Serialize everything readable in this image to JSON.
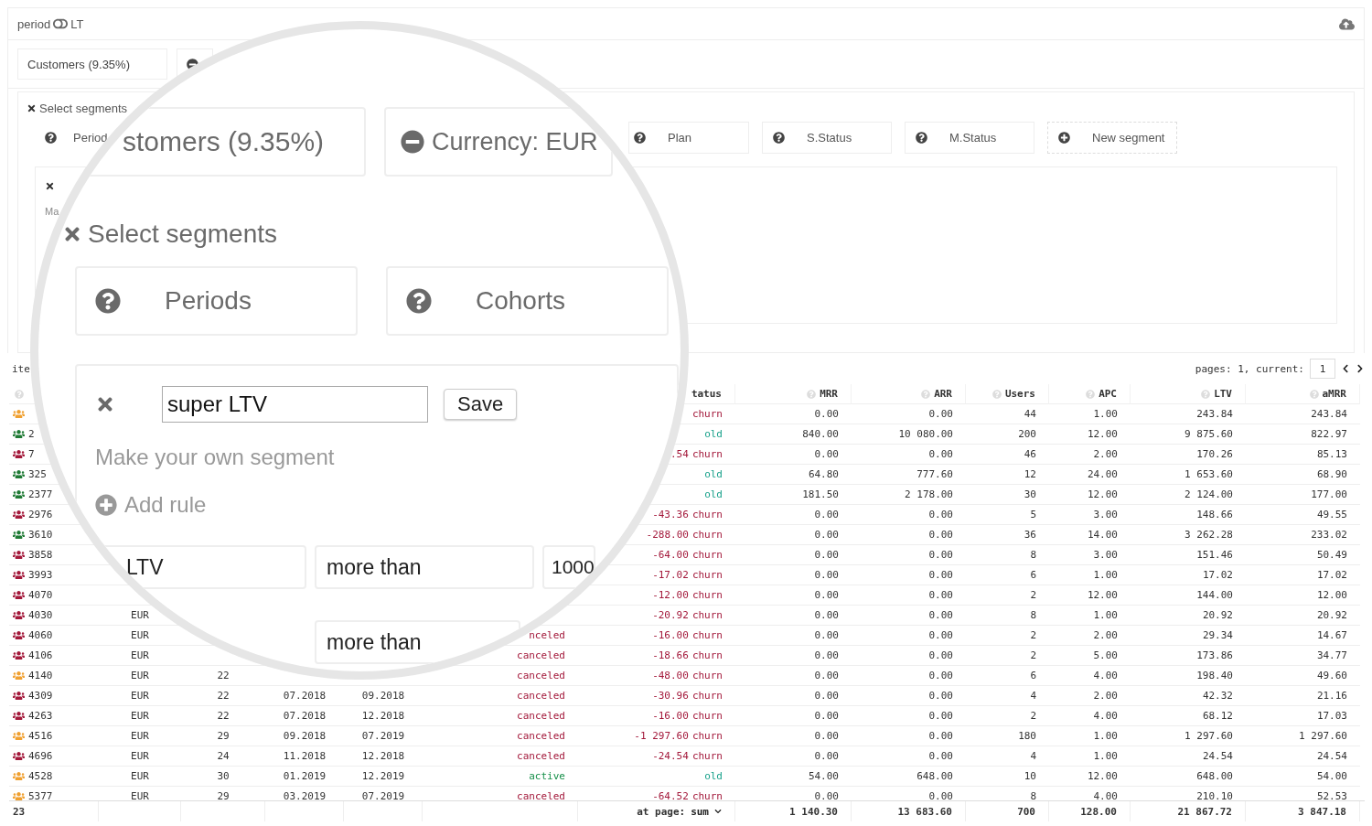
{
  "top_bar": {
    "period_label": "period",
    "on": false,
    "mode_label": "LT"
  },
  "segments": [
    {
      "kind": "label",
      "label": "Customers (9.35%)"
    },
    {
      "kind": "minus"
    }
  ],
  "select_panel": {
    "title": "Select segments",
    "buttons": [
      {
        "kind": "help",
        "label": "Period"
      },
      {
        "kind": "help",
        "label": "Plan"
      },
      {
        "kind": "help",
        "label": "S.Status"
      },
      {
        "kind": "help",
        "label": "M.Status"
      },
      {
        "kind": "new",
        "label": "New segment"
      }
    ],
    "editor_hint": "Ma"
  },
  "magnifier": {
    "segments": [
      {
        "kind": "label",
        "label": "stomers (9.35%)"
      },
      {
        "kind": "minus",
        "label": "Currency: EUR"
      }
    ],
    "title": "Select segments",
    "groups": [
      {
        "label": "Periods"
      },
      {
        "label": "Cohorts"
      }
    ],
    "editor": {
      "name": "super LTV",
      "save": "Save",
      "hint": "Make your own segment",
      "add_rule": "Add rule",
      "rules": [
        {
          "field": "LTV",
          "op": "more than",
          "value": "1000"
        },
        {
          "op": "more than"
        }
      ]
    }
  },
  "pager": {
    "left": "ite",
    "label": "pages: 1, current:",
    "current": "1"
  },
  "table": {
    "columns": [
      {
        "help": true
      },
      {},
      {},
      {},
      {},
      {},
      {
        "label": "tatus"
      },
      {
        "label": "MRR",
        "help": true
      },
      {
        "label": "ARR",
        "help": true
      },
      {
        "label": "Users",
        "help": true
      },
      {
        "label": "APC",
        "help": true
      },
      {
        "label": "LTV",
        "help": true
      },
      {
        "label": "aMRR",
        "help": true
      }
    ],
    "rows": [
      {
        "color": "#f0a030",
        "change": {
          "text": "churn",
          "color": "#a3183a"
        },
        "values": [
          "0.00",
          "0.00",
          "44",
          "1.00",
          "243.84",
          "243.84"
        ]
      },
      {
        "color": "#1e7a34",
        "id": "2",
        "change": {
          "text": "old",
          "color": "#17a08a"
        },
        "values": [
          "840.00",
          "10 080.00",
          "200",
          "12.00",
          "9 875.60",
          "822.97"
        ]
      },
      {
        "color": "#a3183a",
        "id": "7",
        "amount": ".54",
        "change": {
          "text": "churn",
          "color": "#a3183a"
        },
        "values": [
          "0.00",
          "0.00",
          "46",
          "2.00",
          "170.26",
          "85.13"
        ]
      },
      {
        "color": "#1e7a34",
        "id": "325",
        "change": {
          "text": "old",
          "color": "#17a08a"
        },
        "values": [
          "64.80",
          "777.60",
          "12",
          "24.00",
          "1 653.60",
          "68.90"
        ]
      },
      {
        "color": "#1e7a34",
        "id": "2377",
        "change": {
          "text": "old",
          "color": "#17a08a"
        },
        "values": [
          "181.50",
          "2 178.00",
          "30",
          "12.00",
          "2 124.00",
          "177.00"
        ]
      },
      {
        "color": "#a3183a",
        "id": "2976",
        "amount": "-43.36",
        "change": {
          "text": "churn",
          "color": "#a3183a"
        },
        "values": [
          "0.00",
          "0.00",
          "5",
          "3.00",
          "148.66",
          "49.55"
        ]
      },
      {
        "color": "#1e7a34",
        "id": "3610",
        "amount": "-288.00",
        "change": {
          "text": "churn",
          "color": "#a3183a"
        },
        "values": [
          "0.00",
          "0.00",
          "36",
          "14.00",
          "3 262.28",
          "233.02"
        ]
      },
      {
        "color": "#a3183a",
        "id": "3858",
        "amount": "-64.00",
        "change": {
          "text": "churn",
          "color": "#a3183a"
        },
        "values": [
          "0.00",
          "0.00",
          "8",
          "3.00",
          "151.46",
          "50.49"
        ]
      },
      {
        "color": "#a3183a",
        "id": "3993",
        "amount": "-17.02",
        "change": {
          "text": "churn",
          "color": "#a3183a"
        },
        "values": [
          "0.00",
          "0.00",
          "6",
          "1.00",
          "17.02",
          "17.02"
        ]
      },
      {
        "color": "#a3183a",
        "id": "4070",
        "amount": "-12.00",
        "change": {
          "text": "churn",
          "color": "#a3183a"
        },
        "values": [
          "0.00",
          "0.00",
          "2",
          "12.00",
          "144.00",
          "12.00"
        ]
      },
      {
        "color": "#a3183a",
        "id": "4030",
        "currency": "EUR",
        "amount": "-20.92",
        "change": {
          "text": "churn",
          "color": "#a3183a"
        },
        "values": [
          "0.00",
          "0.00",
          "8",
          "1.00",
          "20.92",
          "20.92"
        ]
      },
      {
        "color": "#a3183a",
        "id": "4060",
        "currency": "EUR",
        "status": {
          "text": "nceled",
          "kind": "canceled"
        },
        "amount": "-16.00",
        "change": {
          "text": "churn",
          "color": "#a3183a"
        },
        "values": [
          "0.00",
          "0.00",
          "2",
          "2.00",
          "29.34",
          "14.67"
        ]
      },
      {
        "color": "#a3183a",
        "id": "4106",
        "currency": "EUR",
        "status": {
          "text": "canceled",
          "kind": "canceled"
        },
        "amount": "-18.66",
        "change": {
          "text": "churn",
          "color": "#a3183a"
        },
        "values": [
          "0.00",
          "0.00",
          "2",
          "5.00",
          "173.86",
          "34.77"
        ]
      },
      {
        "color": "#f0a030",
        "id": "4140",
        "currency": "EUR",
        "count": "22",
        "status": {
          "text": "canceled",
          "kind": "canceled"
        },
        "amount": "-48.00",
        "change": {
          "text": "churn",
          "color": "#a3183a"
        },
        "values": [
          "0.00",
          "0.00",
          "6",
          "4.00",
          "198.40",
          "49.60"
        ]
      },
      {
        "color": "#a3183a",
        "id": "4309",
        "currency": "EUR",
        "count": "22",
        "start": "07.2018",
        "end": "09.2018",
        "status": {
          "text": "canceled",
          "kind": "canceled"
        },
        "amount": "-30.96",
        "change": {
          "text": "churn",
          "color": "#a3183a"
        },
        "values": [
          "0.00",
          "0.00",
          "4",
          "2.00",
          "42.32",
          "21.16"
        ]
      },
      {
        "color": "#a3183a",
        "id": "4263",
        "currency": "EUR",
        "count": "22",
        "start": "07.2018",
        "end": "12.2018",
        "status": {
          "text": "canceled",
          "kind": "canceled"
        },
        "amount": "-16.00",
        "change": {
          "text": "churn",
          "color": "#a3183a"
        },
        "values": [
          "0.00",
          "0.00",
          "2",
          "4.00",
          "68.12",
          "17.03"
        ]
      },
      {
        "color": "#f0a030",
        "id": "4516",
        "currency": "EUR",
        "count": "29",
        "start": "09.2018",
        "end": "07.2019",
        "status": {
          "text": "canceled",
          "kind": "canceled"
        },
        "amount": "-1 297.60",
        "change": {
          "text": "churn",
          "color": "#a3183a"
        },
        "values": [
          "0.00",
          "0.00",
          "180",
          "1.00",
          "1 297.60",
          "1 297.60"
        ]
      },
      {
        "color": "#a3183a",
        "id": "4696",
        "currency": "EUR",
        "count": "24",
        "start": "11.2018",
        "end": "12.2018",
        "status": {
          "text": "canceled",
          "kind": "canceled"
        },
        "amount": "-24.54",
        "change": {
          "text": "churn",
          "color": "#a3183a"
        },
        "values": [
          "0.00",
          "0.00",
          "4",
          "1.00",
          "24.54",
          "24.54"
        ]
      },
      {
        "color": "#f0a030",
        "id": "4528",
        "currency": "EUR",
        "count": "30",
        "start": "01.2019",
        "end": "12.2019",
        "status": {
          "text": "active",
          "kind": "active"
        },
        "change": {
          "text": "old",
          "color": "#17a08a"
        },
        "values": [
          "54.00",
          "648.00",
          "10",
          "12.00",
          "648.00",
          "54.00"
        ]
      },
      {
        "color": "#f0a030",
        "id": "5377",
        "currency": "EUR",
        "count": "29",
        "start": "03.2019",
        "end": "07.2019",
        "status": {
          "text": "canceled",
          "kind": "canceled"
        },
        "amount": "-64.52",
        "change": {
          "text": "churn",
          "color": "#a3183a"
        },
        "values": [
          "0.00",
          "0.00",
          "8",
          "4.00",
          "210.10",
          "52.53"
        ]
      }
    ],
    "footer": {
      "count": "23",
      "label": "at page:",
      "aggregate": "sum",
      "totals": [
        "1 140.30",
        "13 683.60",
        "700",
        "128.00",
        "21 867.72",
        "3 847.18"
      ]
    }
  }
}
